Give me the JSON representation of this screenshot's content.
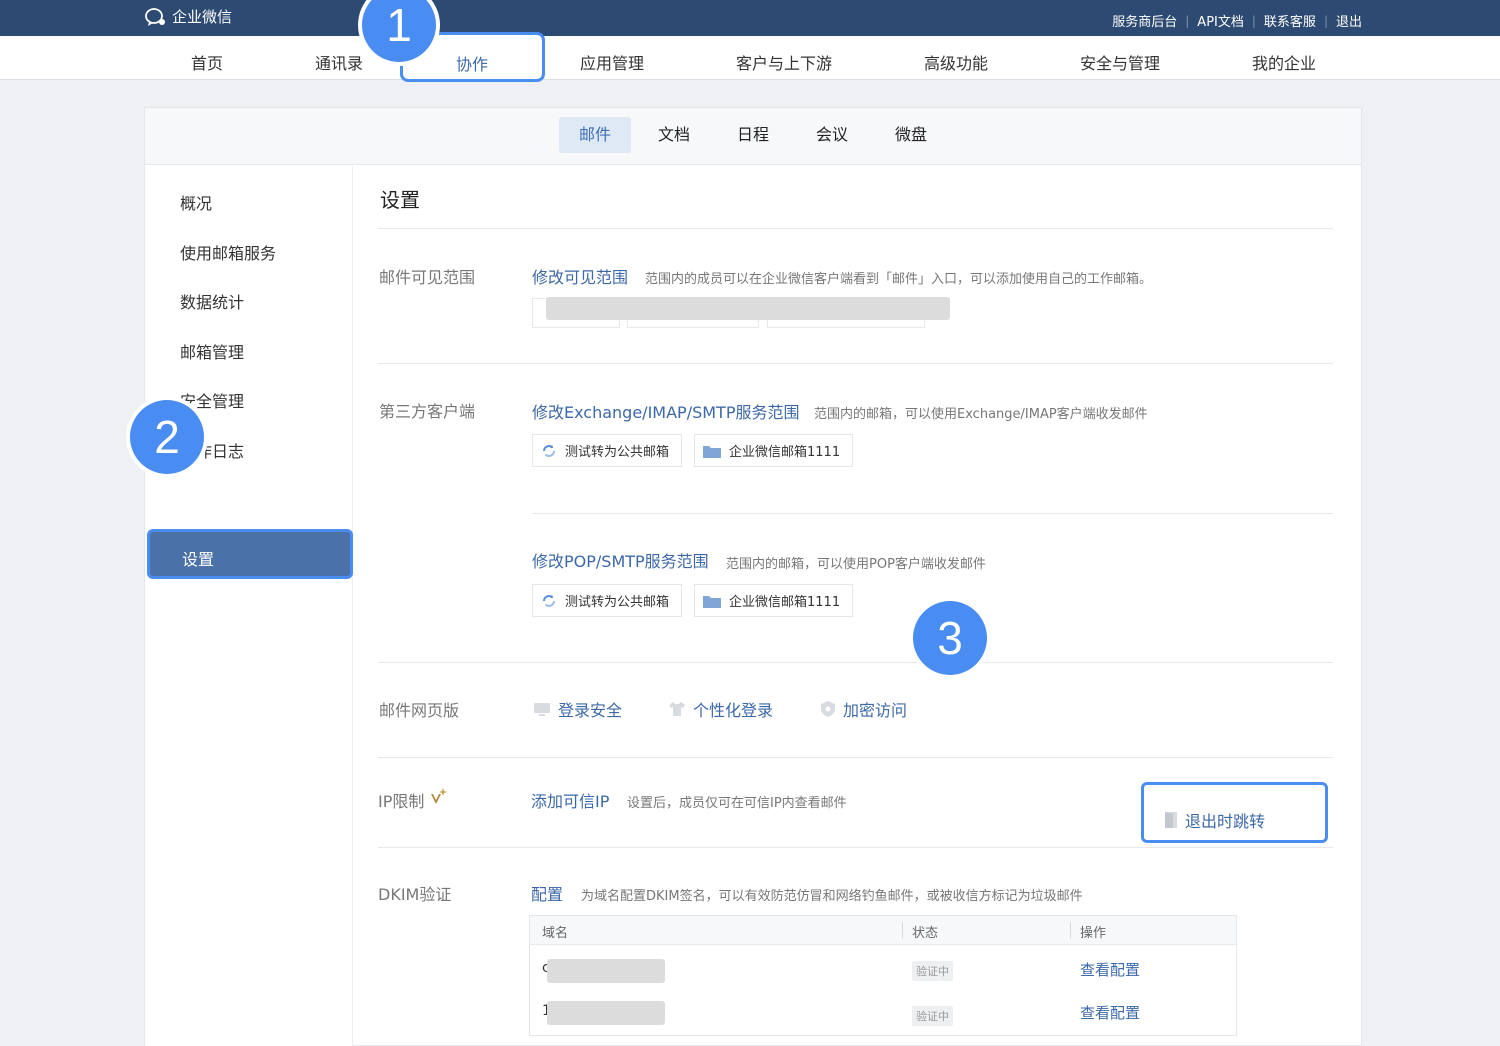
{
  "topbar": {
    "logo_text": "企业微信",
    "links": [
      "服务商后台",
      "API文档",
      "联系客服",
      "退出"
    ]
  },
  "mainnav": {
    "items": [
      "首页",
      "通讯录",
      "协作",
      "应用管理",
      "客户与上下游",
      "高级功能",
      "安全与管理",
      "我的企业"
    ],
    "active": "协作"
  },
  "subtabs": {
    "items": [
      "邮件",
      "文档",
      "日程",
      "会议",
      "微盘"
    ],
    "active": "邮件"
  },
  "sidebar": {
    "items": [
      "概况",
      "使用邮箱服务",
      "数据统计",
      "邮箱管理",
      "安全管理",
      "操作日志",
      "设置"
    ],
    "visible_log_text": "作日志",
    "active": "设置"
  },
  "content": {
    "title": "设置",
    "visible_range": {
      "label": "邮件可见范围",
      "link": "修改可见范围",
      "desc": "范围内的成员可以在企业微信客户端看到「邮件」入口，可以添加使用自己的工作邮箱。"
    },
    "third_party": {
      "label": "第三方客户端",
      "exchange": {
        "link": "修改Exchange/IMAP/SMTP服务范围",
        "desc": "范围内的邮箱，可以使用Exchange/IMAP客户端收发邮件",
        "chips": [
          "测试转为公共邮箱",
          "企业微信邮箱1111"
        ]
      },
      "pop": {
        "link": "修改POP/SMTP服务范围",
        "desc": "范围内的邮箱，可以使用POP客户端收发邮件",
        "chips": [
          "测试转为公共邮箱",
          "企业微信邮箱1111"
        ]
      }
    },
    "web": {
      "label": "邮件网页版",
      "items": [
        "登录安全",
        "个性化登录",
        "加密访问",
        "退出时跳转"
      ]
    },
    "ip": {
      "label": "IP限制",
      "link": "添加可信IP",
      "desc": "设置后，成员仅可在可信IP内查看邮件"
    },
    "dkim": {
      "label": "DKIM验证",
      "link": "配置",
      "desc": "为域名配置DKIM签名，可以有效防范仿冒和网络钓鱼邮件，或被收信方标记为垃圾邮件",
      "columns": [
        "域名",
        "状态",
        "操作"
      ],
      "rows": [
        {
          "domain_prefix": "c",
          "status": "验证中",
          "action": "查看配置"
        },
        {
          "domain_prefix": "1",
          "status": "验证中",
          "action": "查看配置"
        }
      ]
    }
  },
  "annotations": [
    "1",
    "2",
    "3"
  ],
  "colors": {
    "topbar": "#2d4a72",
    "link": "#3c68a8",
    "highlight": "#4a8df2",
    "sidebar_active": "#4b72a8"
  }
}
